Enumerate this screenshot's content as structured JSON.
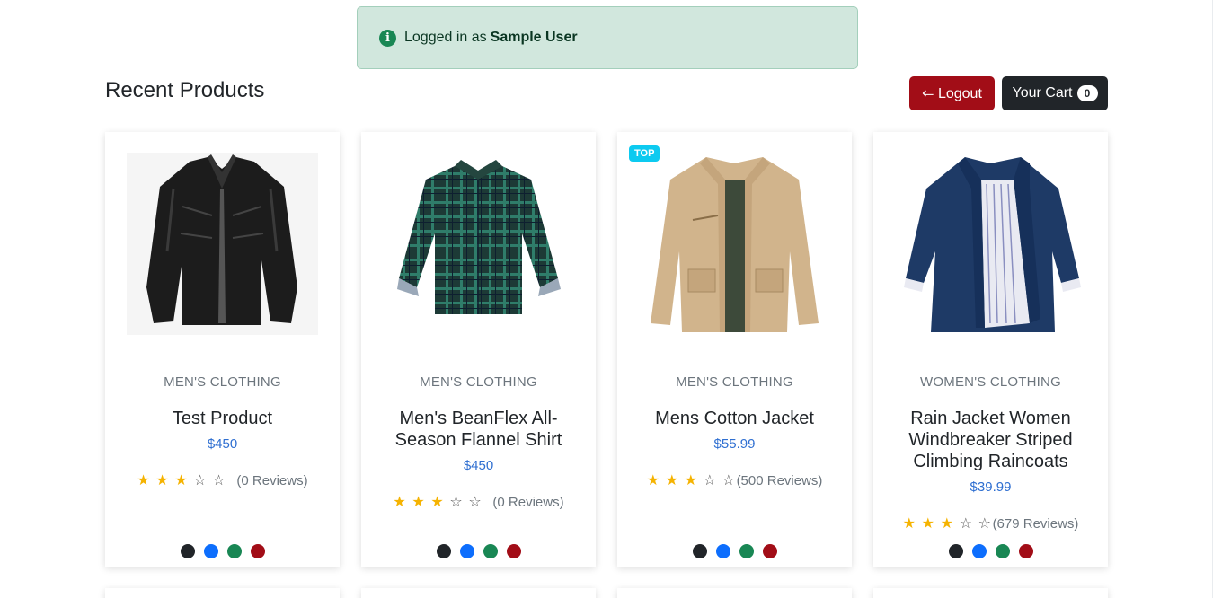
{
  "alert": {
    "prefix": "Logged in as",
    "username": "Sample User"
  },
  "page_title": "Recent Products",
  "buttons": {
    "logout_label": "⇐ Logout",
    "cart_label": "Your Cart",
    "cart_count": "0"
  },
  "colors": {
    "swatches": [
      "#212529",
      "#0d6efd",
      "#198754",
      "#a20d17"
    ]
  },
  "products": [
    {
      "category": "Men's Clothing",
      "name": "Test Product",
      "price": "$450",
      "rating": 3,
      "reviews": "(0 Reviews)",
      "badge": ""
    },
    {
      "category": "Men's Clothing",
      "name": "Men's BeanFlex All-Season Flannel Shirt",
      "price": "$450",
      "rating": 3,
      "reviews": "(0 Reviews)",
      "badge": ""
    },
    {
      "category": "Men's Clothing",
      "name": "Mens Cotton Jacket",
      "price": "$55.99",
      "rating": 3,
      "reviews": "(500 Reviews)",
      "badge": "TOP"
    },
    {
      "category": "Women's Clothing",
      "name": "Rain Jacket Women Windbreaker Striped Climbing Raincoats",
      "price": "$39.99",
      "rating": 3,
      "reviews": "(679 Reviews)",
      "badge": ""
    }
  ]
}
